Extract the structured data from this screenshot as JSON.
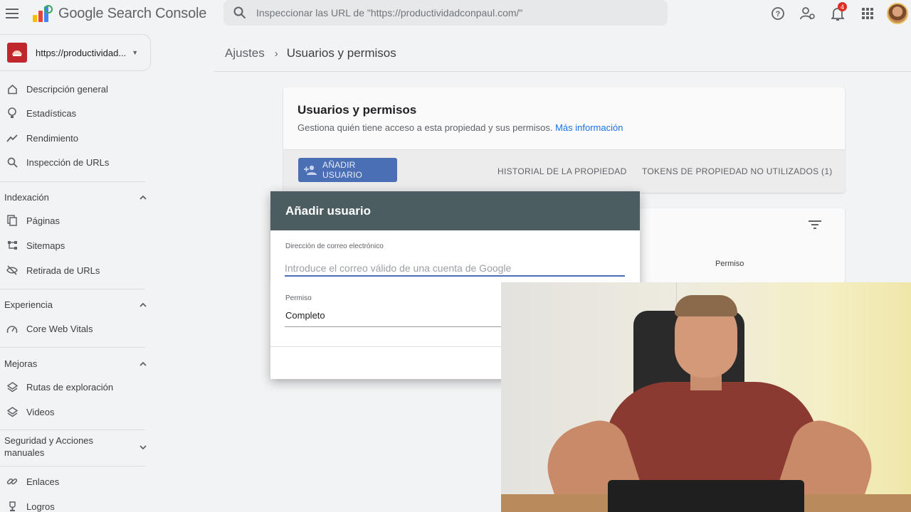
{
  "header": {
    "app_title": "Google Search Console",
    "search_placeholder": "Inspeccionar las URL de \"https://productividadconpaul.com/\"",
    "notification_count": "4",
    "icons": [
      "menu-icon",
      "search-icon",
      "help-icon",
      "manage-accounts-icon",
      "bell-icon",
      "apps-grid-icon",
      "avatar"
    ]
  },
  "sidebar": {
    "property": "https://productividad...",
    "items": [
      {
        "label": "Descripción general",
        "icon": "home-icon"
      },
      {
        "label": "Estadísticas",
        "icon": "lightbulb-icon"
      },
      {
        "label": "Rendimiento",
        "icon": "trending-icon"
      },
      {
        "label": "Inspección de URLs",
        "icon": "search-icon"
      }
    ],
    "sections": [
      {
        "label": "Indexación",
        "items": [
          {
            "label": "Páginas",
            "icon": "pages-icon"
          },
          {
            "label": "Sitemaps",
            "icon": "sitemap-icon"
          },
          {
            "label": "Retirada de URLs",
            "icon": "visibility-off-icon"
          }
        ]
      },
      {
        "label": "Experiencia",
        "items": [
          {
            "label": "Core Web Vitals",
            "icon": "speed-icon"
          }
        ]
      },
      {
        "label": "Mejoras",
        "items": [
          {
            "label": "Rutas de exploración",
            "icon": "layers-icon"
          },
          {
            "label": "Videos",
            "icon": "layers-icon"
          }
        ]
      },
      {
        "label": "Seguridad y Acciones manuales",
        "items": []
      }
    ],
    "bottom_items": [
      {
        "label": "Enlaces",
        "icon": "link-icon"
      },
      {
        "label": "Logros",
        "icon": "trophy-icon"
      }
    ]
  },
  "breadcrumb": {
    "parent": "Ajustes",
    "current": "Usuarios y permisos"
  },
  "card": {
    "title": "Usuarios y permisos",
    "subtitle": "Gestiona quién tiene acceso a esta propiedad y sus permisos.",
    "link": "Más información",
    "add_button": "AÑADIR USUARIO",
    "tab_history": "HISTORIAL DE LA PROPIEDAD",
    "tab_tokens": "TOKENS DE PROPIEDAD NO UTILIZADOS (1)",
    "column_permission": "Permiso"
  },
  "dialog": {
    "title": "Añadir usuario",
    "email_label": "Dirección de correo electrónico",
    "email_placeholder": "Introduce el correo válido de una cuenta de Google",
    "permission_label": "Permiso",
    "permission_value": "Completo"
  },
  "colors": {
    "accent": "#4a6fb5",
    "dialog_header": "#4b5d61",
    "link": "#1a73e8"
  }
}
